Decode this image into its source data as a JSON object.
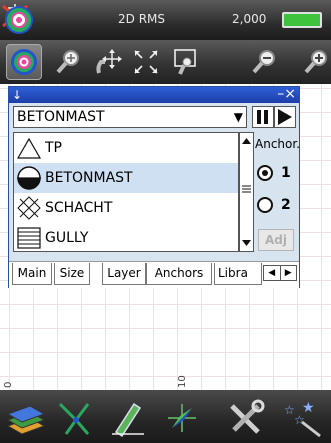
{
  "status": {
    "mode": "2D RMS",
    "scale": "2,000"
  },
  "toolbar": {
    "buttons": [
      "gps-target-icon",
      "zoom-in-icon",
      "pan-icon",
      "zoom-extent-icon",
      "zoom-window-icon",
      "zoom-out-icon",
      "zoom-in-plus-icon"
    ]
  },
  "panel": {
    "selected_symbol": "BETONMAST",
    "list": [
      {
        "label": "TP",
        "icon": "triangle-icon"
      },
      {
        "label": "BETONMAST",
        "icon": "half-circle-icon"
      },
      {
        "label": "SCHACHT",
        "icon": "cross-square-icon"
      },
      {
        "label": "GULLY",
        "icon": "grate-icon"
      }
    ],
    "anchor_label": "Anchor.",
    "anchor_options": [
      "1",
      "2"
    ],
    "anchor_selected": "1",
    "adj_label": "Adj",
    "tabs": [
      "Main",
      "Size",
      "Layer",
      "Anchors",
      "Libra"
    ]
  },
  "map": {
    "axis_labels": [
      "0",
      "10"
    ]
  },
  "bottombar": {
    "buttons": [
      "layers-icon",
      "vertex-icon",
      "draw-pen-icon",
      "compass-icon",
      "tools-icon",
      "wizard-stars-icon"
    ]
  },
  "colors": {
    "title_blue": "#2b55c8",
    "panel_bg": "#d7e3ee",
    "battery_green": "#3fc33f"
  }
}
